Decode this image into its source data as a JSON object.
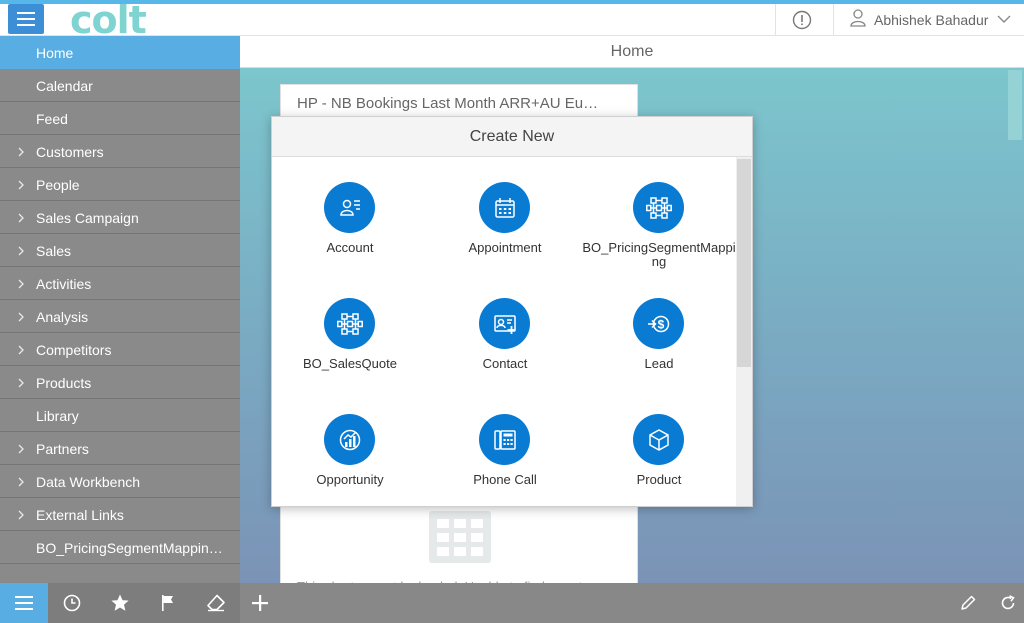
{
  "header": {
    "logo": "colt",
    "user_name": "Abhishek Bahadur"
  },
  "sidebar": {
    "items": [
      {
        "label": "Home",
        "expandable": false,
        "active": true
      },
      {
        "label": "Calendar",
        "expandable": false
      },
      {
        "label": "Feed",
        "expandable": false
      },
      {
        "label": "Customers",
        "expandable": true
      },
      {
        "label": "People",
        "expandable": true
      },
      {
        "label": "Sales Campaign",
        "expandable": true
      },
      {
        "label": "Sales",
        "expandable": true
      },
      {
        "label": "Activities",
        "expandable": true
      },
      {
        "label": "Analysis",
        "expandable": true
      },
      {
        "label": "Competitors",
        "expandable": true
      },
      {
        "label": "Products",
        "expandable": true
      },
      {
        "label": "Library",
        "expandable": false
      },
      {
        "label": "Partners",
        "expandable": true
      },
      {
        "label": "Data Workbench",
        "expandable": true
      },
      {
        "label": "External Links",
        "expandable": true
      },
      {
        "label": "BO_PricingSegmentMappin…",
        "expandable": false
      }
    ]
  },
  "page": {
    "title": "Home"
  },
  "card": {
    "title": "HP - NB Bookings Last Month ARR+AU Eu…",
    "footer_text": "This chart cannot be loaded. Unable to find report"
  },
  "dialog": {
    "title": "Create New",
    "tiles": [
      {
        "label": "Account",
        "icon": "account-icon"
      },
      {
        "label": "Appointment",
        "icon": "calendar-icon"
      },
      {
        "label": "BO_PricingSegmentMapping",
        "icon": "network-icon"
      },
      {
        "label": "BO_SalesQuote",
        "icon": "network-icon"
      },
      {
        "label": "Contact",
        "icon": "contact-card-icon"
      },
      {
        "label": "Lead",
        "icon": "lead-dollar-icon"
      },
      {
        "label": "Opportunity",
        "icon": "opportunity-chart-icon"
      },
      {
        "label": "Phone Call",
        "icon": "phone-icon"
      },
      {
        "label": "Product",
        "icon": "product-box-icon"
      }
    ]
  },
  "colors": {
    "accent": "#58aee3",
    "tile_blue": "#0a7bd2",
    "sidebar_bg": "#8a8a8a"
  }
}
